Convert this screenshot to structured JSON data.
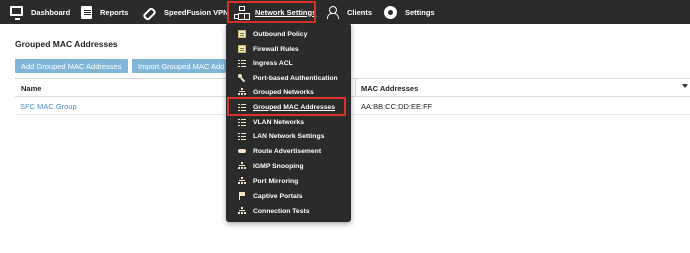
{
  "nav": {
    "items": [
      {
        "label": "Dashboard",
        "icon": "monitor-icon"
      },
      {
        "label": "Reports",
        "icon": "document-icon"
      },
      {
        "label": "SpeedFusion VPN",
        "icon": "link-icon"
      },
      {
        "label": "Network Settings",
        "icon": "network-tree-icon"
      },
      {
        "label": "Clients",
        "icon": "user-icon"
      },
      {
        "label": "Settings",
        "icon": "gear-icon"
      }
    ],
    "active_highlight_color": "#d9342b"
  },
  "page": {
    "title": "Grouped MAC Addresses",
    "buttons": {
      "add": "Add Grouped MAC Addresses",
      "import": "Import Grouped MAC Add"
    },
    "table": {
      "columns": [
        "Name",
        "MAC Addresses"
      ],
      "rows": [
        {
          "name": "SFC MAC Group",
          "mac": "AA:BB:CC:DD:EE:FF"
        }
      ]
    }
  },
  "dropdown": {
    "items": [
      {
        "label": "Outbound Policy",
        "icon": "document-icon"
      },
      {
        "label": "Firewall Rules",
        "icon": "document-icon"
      },
      {
        "label": "Ingress ACL",
        "icon": "list-icon"
      },
      {
        "label": "Port-based Authentication",
        "icon": "key-icon"
      },
      {
        "label": "Grouped Networks",
        "icon": "network-tree-icon"
      },
      {
        "label": "Grouped MAC Addresses",
        "icon": "list-icon"
      },
      {
        "label": "VLAN Networks",
        "icon": "list-icon"
      },
      {
        "label": "LAN Network Settings",
        "icon": "list-icon"
      },
      {
        "label": "Route Advertisement",
        "icon": "antenna-icon"
      },
      {
        "label": "IGMP Snooping",
        "icon": "network-tree-icon"
      },
      {
        "label": "Port Mirroring",
        "icon": "network-tree-icon"
      },
      {
        "label": "Captive Portals",
        "icon": "flag-icon"
      },
      {
        "label": "Connection Tests",
        "icon": "network-tree-icon"
      }
    ],
    "selected": "Grouped MAC Addresses"
  }
}
